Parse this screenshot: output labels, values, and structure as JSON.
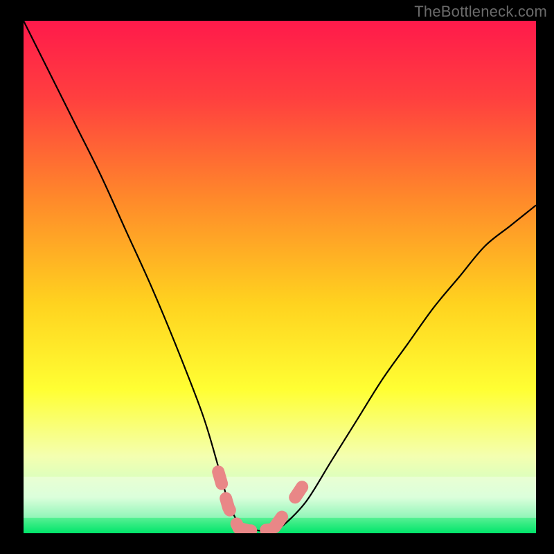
{
  "watermark": "TheBottleneck.com",
  "chart_data": {
    "type": "line",
    "title": "",
    "xlabel": "",
    "ylabel": "",
    "xlim": [
      0,
      100
    ],
    "ylim": [
      0,
      100
    ],
    "background_gradient": {
      "stops": [
        {
          "offset": 0.0,
          "color": "#ff1a4b"
        },
        {
          "offset": 0.15,
          "color": "#ff3f3f"
        },
        {
          "offset": 0.35,
          "color": "#ff8a2a"
        },
        {
          "offset": 0.55,
          "color": "#ffd21f"
        },
        {
          "offset": 0.72,
          "color": "#ffff33"
        },
        {
          "offset": 0.85,
          "color": "#f4ffb0"
        },
        {
          "offset": 0.93,
          "color": "#c8ffc8"
        },
        {
          "offset": 1.0,
          "color": "#00e56a"
        }
      ]
    },
    "series": [
      {
        "name": "bottleneck-curve",
        "color": "#000000",
        "x": [
          0,
          5,
          10,
          15,
          20,
          25,
          30,
          35,
          38,
          40,
          42,
          44,
          46,
          48,
          50,
          55,
          60,
          65,
          70,
          75,
          80,
          85,
          90,
          95,
          100
        ],
        "y": [
          100,
          90,
          80,
          70,
          59,
          48,
          36,
          23,
          13,
          6,
          2,
          1,
          0.5,
          0.5,
          1,
          6,
          14,
          22,
          30,
          37,
          44,
          50,
          56,
          60,
          64
        ]
      }
    ],
    "highlight": {
      "name": "sweet-zone-markers",
      "color": "#e98787",
      "segments": [
        {
          "x": [
            38,
            40,
            42
          ],
          "y": [
            12,
            5,
            1
          ]
        },
        {
          "x": [
            42,
            44,
            46,
            48
          ],
          "y": [
            1,
            0.5,
            0.5,
            0.7
          ]
        },
        {
          "x": [
            49,
            51
          ],
          "y": [
            1.2,
            4
          ]
        },
        {
          "x": [
            53,
            55
          ],
          "y": [
            7,
            10
          ]
        }
      ]
    }
  }
}
